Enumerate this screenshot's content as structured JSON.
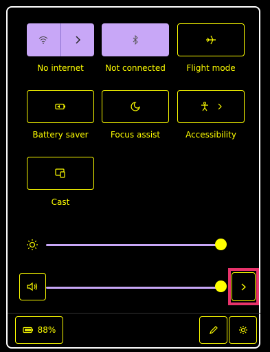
{
  "tiles": {
    "wifi": {
      "label": "No internet",
      "icon": "wifi-icon",
      "expand_icon": "chevron-right-icon",
      "active": true
    },
    "bluetooth": {
      "label": "Not connected",
      "icon": "bluetooth-icon",
      "active": true
    },
    "flight_mode": {
      "label": "Flight mode",
      "icon": "airplane-icon",
      "active": false
    },
    "battery_saver": {
      "label": "Battery saver",
      "icon": "battery-saver-icon",
      "active": false
    },
    "focus_assist": {
      "label": "Focus assist",
      "icon": "moon-icon",
      "active": false
    },
    "accessibility": {
      "label": "Accessibility",
      "icon": "accessibility-icon",
      "expand_icon": "chevron-right-icon",
      "active": false
    },
    "cast": {
      "label": "Cast",
      "icon": "cast-icon",
      "active": false
    }
  },
  "brightness": {
    "icon": "brightness-icon",
    "value": 1.0
  },
  "volume": {
    "icon": "speaker-icon",
    "value": 1.0,
    "expand_icon": "chevron-right-icon"
  },
  "footer": {
    "battery_icon": "battery-icon",
    "battery_percent": "88%",
    "edit_icon": "pencil-icon",
    "settings_icon": "gear-icon"
  },
  "colors": {
    "accent": "#c8a7f7",
    "highlight_text": "#ffff00",
    "focus_ring": "#e8336b",
    "background": "#000000"
  }
}
